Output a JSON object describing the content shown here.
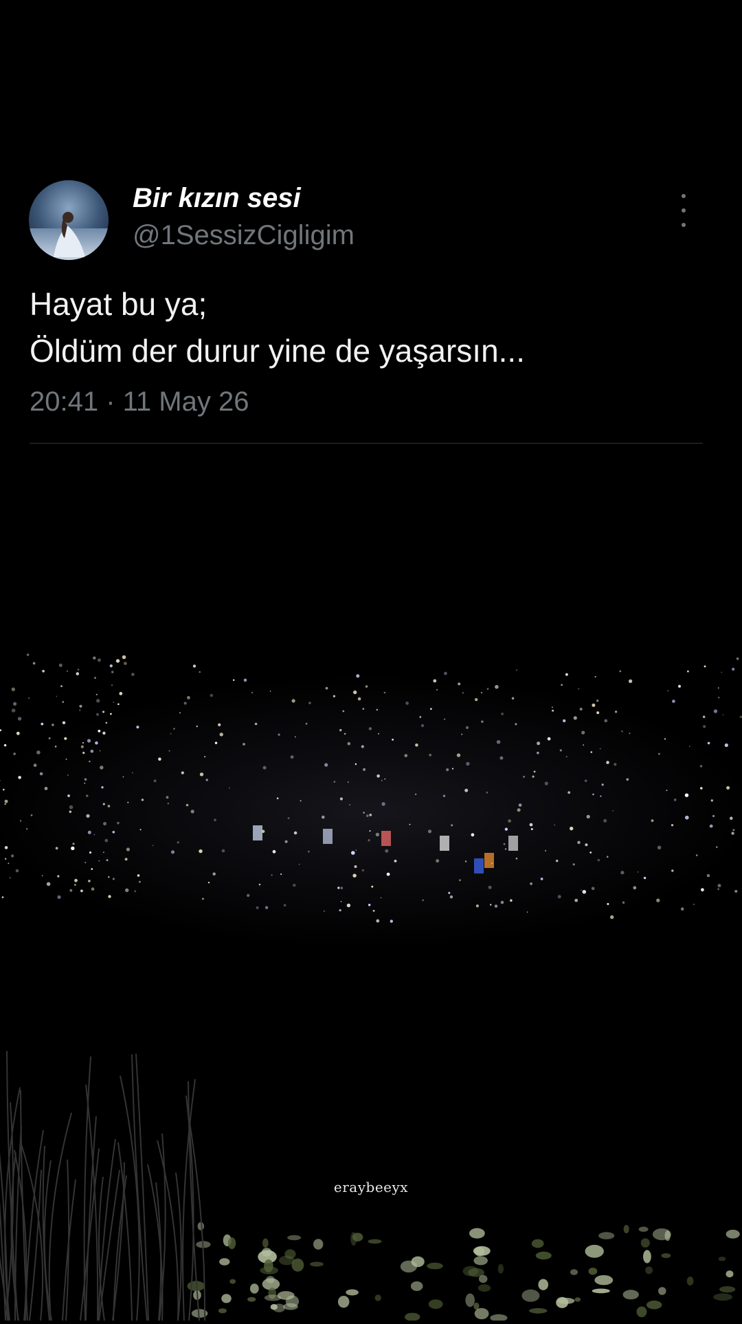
{
  "tweet": {
    "display_name": "Bir kızın sesi",
    "handle": "@1SessizCigligim",
    "text_lines": [
      "Hayat bu ya;",
      "Öldüm der durur yine de yaşarsın..."
    ],
    "timestamp": "20:41 · 11 May 26",
    "avatar": "avatar-woman-in-white-dress",
    "more_icon": "more-options-icon"
  },
  "background": {
    "scene": "night-city-lights",
    "watermark": "eraybeeyx"
  },
  "colors": {
    "background": "#000000",
    "text": "#f2f2f2",
    "secondary_text": "#71767b",
    "divider": "#2f3336"
  }
}
